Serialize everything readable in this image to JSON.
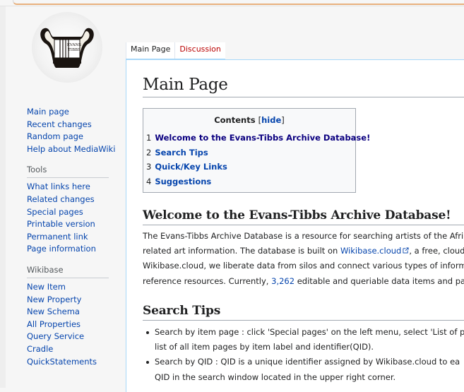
{
  "tabs": [
    {
      "label": "Main Page"
    },
    {
      "label": "Discussion"
    }
  ],
  "logo": {
    "text_lines": [
      "EVANS",
      "TIBBS"
    ]
  },
  "nav": {
    "items": [
      {
        "label": "Main page"
      },
      {
        "label": "Recent changes"
      },
      {
        "label": "Random page"
      },
      {
        "label": "Help about MediaWiki"
      }
    ]
  },
  "tools": {
    "heading": "Tools",
    "items": [
      {
        "label": "What links here"
      },
      {
        "label": "Related changes"
      },
      {
        "label": "Special pages"
      },
      {
        "label": "Printable version"
      },
      {
        "label": "Permanent link"
      },
      {
        "label": "Page information"
      }
    ]
  },
  "wikibase": {
    "heading": "Wikibase",
    "items": [
      {
        "label": "New Item"
      },
      {
        "label": "New Property"
      },
      {
        "label": "New Schema"
      },
      {
        "label": "All Properties"
      },
      {
        "label": "Query Service"
      },
      {
        "label": "Cradle"
      },
      {
        "label": "QuickStatements"
      }
    ]
  },
  "page": {
    "title": "Main Page"
  },
  "toc": {
    "title": "Contents",
    "hide_open": "[",
    "hide_label": "hide",
    "hide_close": "]",
    "items": [
      {
        "num": "1",
        "label": "Welcome to the Evans-Tibbs Archive Database!"
      },
      {
        "num": "2",
        "label": "Search Tips"
      },
      {
        "num": "3",
        "label": "Quick/Key Links"
      },
      {
        "num": "4",
        "label": "Suggestions"
      }
    ]
  },
  "welcome": {
    "heading": "Welcome to the Evans-Tibbs Archive Database!",
    "line1": "The Evans-Tibbs Archive Database is a resource for searching artists of the Afri",
    "line2_pre": "related art information. The database is built on ",
    "line2_link": "Wikibase.cloud",
    "line2_post": ", a free, cloud",
    "line3": "Wikibase.cloud, we liberate data from silos and connect various types of inform",
    "line4_pre": "reference resources. Currently, ",
    "line4_link": "3,262",
    "line4_post": " editable and queriable data items and pag"
  },
  "search_tips": {
    "heading": "Search Tips",
    "bullet1_line1": "Search by item page : click 'Special pages' on the left menu, select 'List of p",
    "bullet1_line2": "list of all item pages by item label and identifier(QID).",
    "bullet2_line1": "Search by QID : QID is a unique identifier assigned by Wikibase.cloud to ea",
    "bullet2_line2": "QID in the search window located in the upper right corner."
  },
  "colors": {
    "link": "#0645ad",
    "visited_link": "#0b0080",
    "new_link": "#ba0000",
    "text": "#202122",
    "border": "#a2a9b1",
    "tab_border": "#a7d7f9"
  }
}
